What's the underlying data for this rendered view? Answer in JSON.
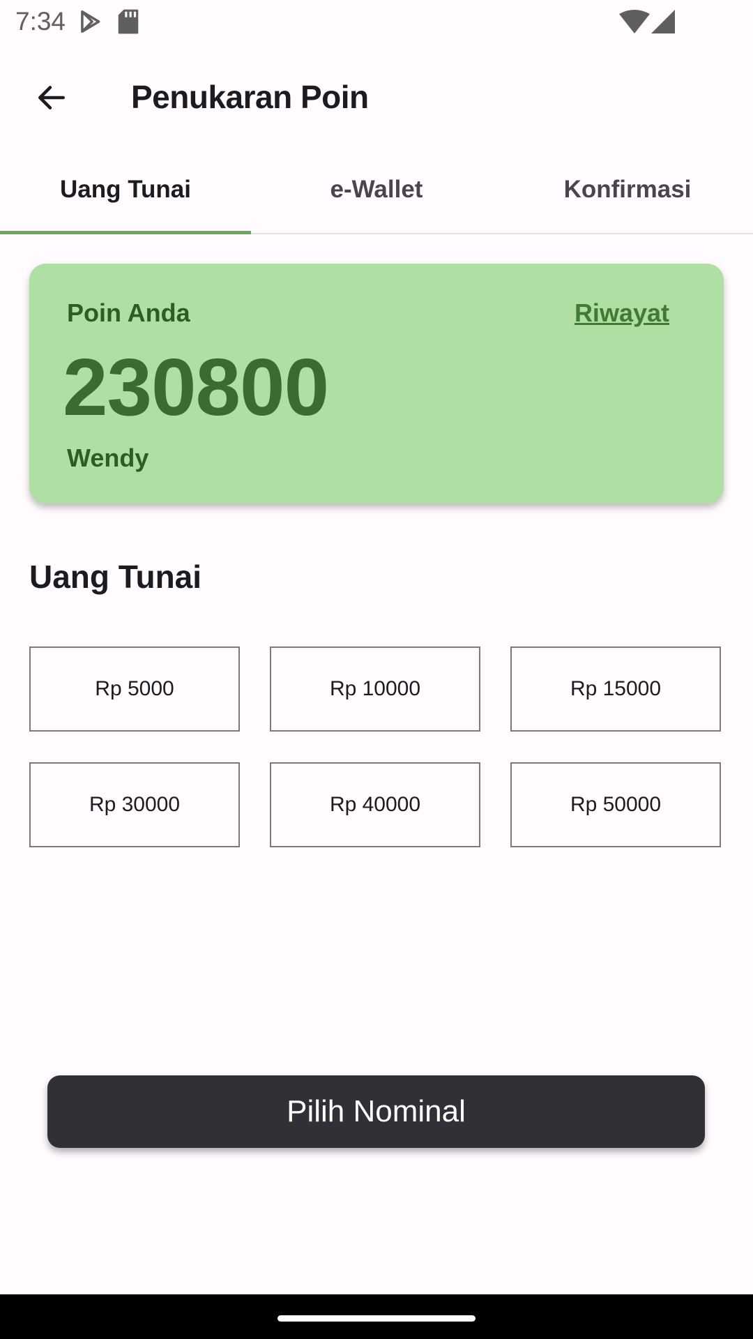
{
  "status_bar": {
    "time": "7:34",
    "icons": [
      "play-store-icon",
      "sd-card-icon",
      "wifi-icon",
      "signal-icon"
    ]
  },
  "app_bar": {
    "title": "Penukaran Poin",
    "back_icon": "arrow-left-icon"
  },
  "tabs": [
    {
      "label": "Uang Tunai",
      "active": true
    },
    {
      "label": "e-Wallet",
      "active": false
    },
    {
      "label": "Konfirmasi",
      "active": false
    }
  ],
  "points_card": {
    "label": "Poin Anda",
    "history_link": "Riwayat",
    "points": "230800",
    "user_name": "Wendy"
  },
  "section": {
    "title": "Uang Tunai"
  },
  "nominal_options": [
    "Rp 5000",
    "Rp 10000",
    "Rp 15000",
    "Rp 30000",
    "Rp 40000",
    "Rp 50000"
  ],
  "primary_button": {
    "label": "Pilih Nominal"
  },
  "colors": {
    "accent": "#6aa85f",
    "card_background": "#afdfa2",
    "points_text": "#3b6b2e",
    "button_background": "#313036",
    "page_background": "#fffbfe"
  }
}
